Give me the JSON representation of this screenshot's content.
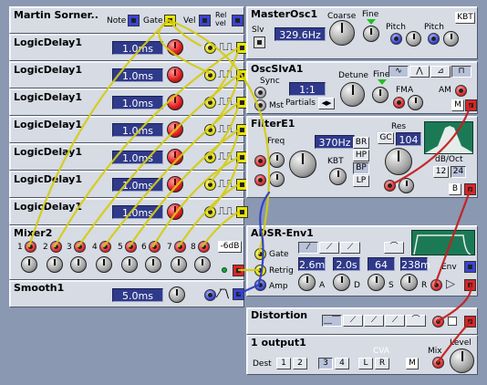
{
  "modules": {
    "martin": {
      "title": "Martin Sorner..",
      "note": "Note",
      "gate": "Gate",
      "vel": "Vel",
      "relvel": "Rel vel"
    },
    "ld1": {
      "title": "LogicDelay1",
      "value": "1.0ms"
    },
    "ld2": {
      "title": "LogicDelay1",
      "value": "1.0ms"
    },
    "ld3": {
      "title": "LogicDelay1",
      "value": "1.0ms"
    },
    "ld4": {
      "title": "LogicDelay1",
      "value": "1.0ms"
    },
    "ld5": {
      "title": "LogicDelay1",
      "value": "1.0ms"
    },
    "ld6": {
      "title": "LogicDelay1",
      "value": "1.0ms"
    },
    "ld7": {
      "title": "LogicDelay1",
      "value": "1.0ms"
    },
    "mixer": {
      "title": "Mixer2",
      "inputs": [
        "1",
        "2",
        "3",
        "4",
        "5",
        "6",
        "7",
        "8"
      ],
      "att": "-6dB"
    },
    "smooth": {
      "title": "Smooth1",
      "value": "5.0ms"
    },
    "masterosc": {
      "title": "MasterOsc1",
      "slv": "Slv",
      "coarse": "Coarse",
      "fine": "Fine",
      "freq": "329.6Hz",
      "pitch1": "Pitch",
      "pitch2": "Pitch",
      "kbt": "KBT"
    },
    "oscslv": {
      "title": "OscSlvA1",
      "sync": "Sync",
      "mst": "Mst",
      "partials_value": "1:1",
      "partials": "Partials",
      "detune": "Detune",
      "fine": "Fine",
      "fma": "FMA",
      "am": "AM",
      "m": "M"
    },
    "filter": {
      "title": "FilterE1",
      "freq": "Freq",
      "freq_value": "370Hz",
      "kbt": "KBT",
      "modes": [
        "BR",
        "HP",
        "BP",
        "LP"
      ],
      "res": "Res",
      "gc": "GC",
      "res_value": "104",
      "db_oct": "dB/Oct",
      "slope1": "12",
      "slope2": "24",
      "b": "B"
    },
    "adsr": {
      "title": "ADSR-Env1",
      "gate": "Gate",
      "retrig": "Retrig",
      "amp": "Amp",
      "a_value": "2.6m",
      "d_value": "2.0s",
      "s_value": "64",
      "r_value": "238m",
      "a": "A",
      "d": "D",
      "s": "S",
      "r": "R",
      "env": "Env"
    },
    "distortion": {
      "title": "Distortion"
    },
    "output": {
      "title": "1 output1",
      "dest": "Dest",
      "dests": [
        "1",
        "2",
        "3",
        "4",
        "L",
        "R"
      ],
      "cva": "CVA",
      "mix": "Mix",
      "level": "Level",
      "m": "M"
    }
  },
  "colors": {
    "background": "#8a98b2",
    "panel": "#d6dbe4",
    "display": "#2f3a8a",
    "cable_yellow": "#d4cc10",
    "cable_red": "#c42020",
    "cable_blue": "#2c3ec8"
  }
}
